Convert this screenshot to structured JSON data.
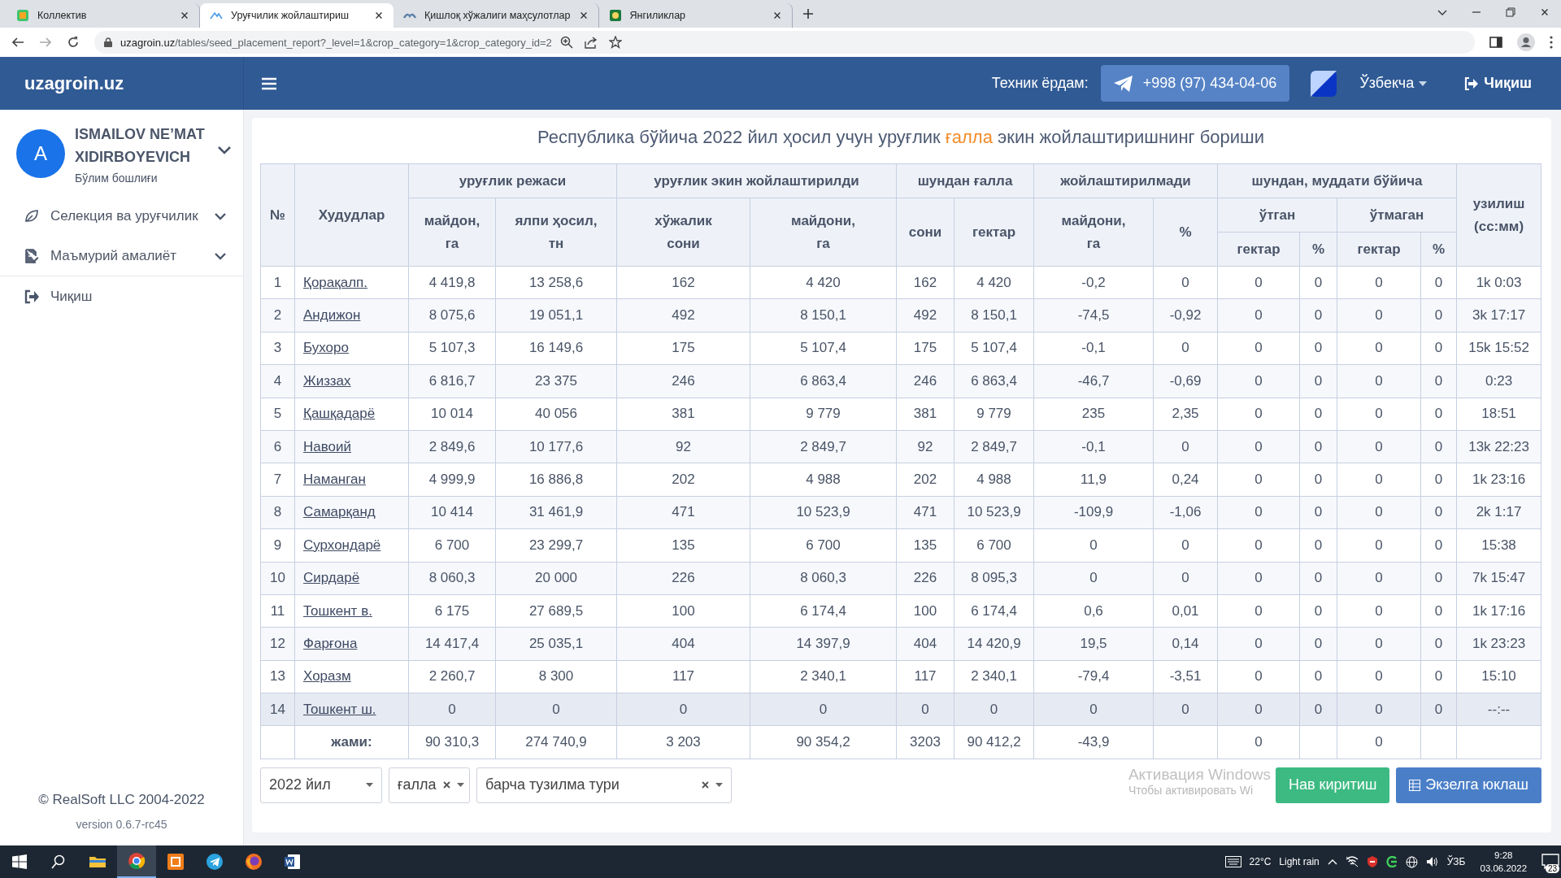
{
  "browser": {
    "tabs": [
      {
        "title": "Коллектив",
        "selected": false
      },
      {
        "title": "Уруғчилик жойлаштириш",
        "selected": true
      },
      {
        "title": "Қишлоқ хўжалиги маҳсулотлар",
        "selected": false
      },
      {
        "title": "Янгиликлар",
        "selected": false
      }
    ],
    "url_host": "uzagroin.uz",
    "url_path": "/tables/seed_placement_report?_level=1&crop_category=1&crop_category_id=2"
  },
  "header": {
    "brand": "uzagroin.uz",
    "support_label": "Техник ёрдам:",
    "phone": "+998 (97) 434-04-06",
    "language": "Ўзбекча",
    "logout": "Чиқиш"
  },
  "sidebar": {
    "user": {
      "initial": "A",
      "name": "ISMAILOV NE’MAT XIDIRBOYEVICH",
      "role": "Бўлим бошлиғи"
    },
    "menu": [
      {
        "kind": "leaf",
        "label": "Селекция ва уруғчилик",
        "expandable": true
      },
      {
        "kind": "document",
        "label": "Маъмурий амалиёт",
        "expandable": true
      },
      {
        "kind": "exit",
        "label": "Чиқиш",
        "expandable": false
      }
    ],
    "copyright": "© RealSoft LLC 2004-2022",
    "version": "version 0.6.7-rc45"
  },
  "report": {
    "title_before": "Республика бўйича 2022 йил ҳосил учун уруғлик ",
    "title_highlight": "ғалла",
    "title_after": " экин жойлаштиришнинг бориши",
    "header_rows": [
      [
        {
          "text": "№",
          "rowspan": 3
        },
        {
          "text": "Худудлар",
          "rowspan": 3
        },
        {
          "text": "уруғлик режаси",
          "colspan": 2
        },
        {
          "text": "уруғлик экин жойлаштирилди",
          "colspan": 2
        },
        {
          "text": "шундан ғалла",
          "colspan": 2
        },
        {
          "text": "жойлаштирилмади",
          "colspan": 2
        },
        {
          "text": "шундан, муддати бўйича",
          "colspan": 4
        },
        {
          "text": "узилиш\n(сс:мм)",
          "rowspan": 3
        }
      ],
      [
        {
          "text": "майдон,\nга",
          "rowspan": 2
        },
        {
          "text": "ялпи ҳосил,\nтн",
          "rowspan": 2
        },
        {
          "text": "хўжалик\nсони",
          "rowspan": 2
        },
        {
          "text": "майдони,\nга",
          "rowspan": 2
        },
        {
          "text": "сони",
          "rowspan": 2
        },
        {
          "text": "гектар",
          "rowspan": 2
        },
        {
          "text": "майдони,\nга",
          "rowspan": 2
        },
        {
          "text": "%",
          "rowspan": 2
        },
        {
          "text": "ўтган",
          "colspan": 2
        },
        {
          "text": "ўтмаган",
          "colspan": 2
        }
      ],
      [
        {
          "text": "гектар"
        },
        {
          "text": "%"
        },
        {
          "text": "гектар"
        },
        {
          "text": "%"
        }
      ]
    ],
    "rows": [
      {
        "no": "1",
        "region": "Қорақалп.",
        "highlighted": false,
        "values": [
          "4 419,8",
          "13 258,6",
          "162",
          "4 420",
          "162",
          "4 420",
          "-0,2",
          "0",
          "0",
          "0",
          "0",
          "0",
          "1k 0:03"
        ]
      },
      {
        "no": "2",
        "region": "Андижон",
        "highlighted": false,
        "values": [
          "8 075,6",
          "19 051,1",
          "492",
          "8 150,1",
          "492",
          "8 150,1",
          "-74,5",
          "-0,92",
          "0",
          "0",
          "0",
          "0",
          "3k 17:17"
        ]
      },
      {
        "no": "3",
        "region": "Бухоро",
        "highlighted": false,
        "values": [
          "5 107,3",
          "16 149,6",
          "175",
          "5 107,4",
          "175",
          "5 107,4",
          "-0,1",
          "0",
          "0",
          "0",
          "0",
          "0",
          "15k 15:52"
        ]
      },
      {
        "no": "4",
        "region": "Жиззах",
        "highlighted": false,
        "values": [
          "6 816,7",
          "23 375",
          "246",
          "6 863,4",
          "246",
          "6 863,4",
          "-46,7",
          "-0,69",
          "0",
          "0",
          "0",
          "0",
          "0:23"
        ]
      },
      {
        "no": "5",
        "region": "Қашқадарё",
        "highlighted": false,
        "values": [
          "10 014",
          "40 056",
          "381",
          "9 779",
          "381",
          "9 779",
          "235",
          "2,35",
          "0",
          "0",
          "0",
          "0",
          "18:51"
        ]
      },
      {
        "no": "6",
        "region": "Навоий",
        "highlighted": false,
        "values": [
          "2 849,6",
          "10 177,6",
          "92",
          "2 849,7",
          "92",
          "2 849,7",
          "-0,1",
          "0",
          "0",
          "0",
          "0",
          "0",
          "13k 22:23"
        ]
      },
      {
        "no": "7",
        "region": "Наманган",
        "highlighted": false,
        "values": [
          "4 999,9",
          "16 886,8",
          "202",
          "4 988",
          "202",
          "4 988",
          "11,9",
          "0,24",
          "0",
          "0",
          "0",
          "0",
          "1k 23:16"
        ]
      },
      {
        "no": "8",
        "region": "Самарқанд",
        "highlighted": false,
        "values": [
          "10 414",
          "31 461,9",
          "471",
          "10 523,9",
          "471",
          "10 523,9",
          "-109,9",
          "-1,06",
          "0",
          "0",
          "0",
          "0",
          "2k 1:17"
        ]
      },
      {
        "no": "9",
        "region": "Сурхондарё",
        "highlighted": false,
        "values": [
          "6 700",
          "23 299,7",
          "135",
          "6 700",
          "135",
          "6 700",
          "0",
          "0",
          "0",
          "0",
          "0",
          "0",
          "15:38"
        ]
      },
      {
        "no": "10",
        "region": "Сирдарё",
        "highlighted": false,
        "values": [
          "8 060,3",
          "20 000",
          "226",
          "8 060,3",
          "226",
          "8 095,3",
          "0",
          "0",
          "0",
          "0",
          "0",
          "0",
          "7k 15:47"
        ]
      },
      {
        "no": "11",
        "region": "Тошкент в.",
        "highlighted": false,
        "values": [
          "6 175",
          "27 689,5",
          "100",
          "6 174,4",
          "100",
          "6 174,4",
          "0,6",
          "0,01",
          "0",
          "0",
          "0",
          "0",
          "1k 17:16"
        ]
      },
      {
        "no": "12",
        "region": "Фарғона",
        "highlighted": false,
        "values": [
          "14 417,4",
          "25 035,1",
          "404",
          "14 397,9",
          "404",
          "14 420,9",
          "19,5",
          "0,14",
          "0",
          "0",
          "0",
          "0",
          "1k 23:23"
        ]
      },
      {
        "no": "13",
        "region": "Хоразм",
        "highlighted": false,
        "values": [
          "2 260,7",
          "8 300",
          "117",
          "2 340,1",
          "117",
          "2 340,1",
          "-79,4",
          "-3,51",
          "0",
          "0",
          "0",
          "0",
          "15:10"
        ]
      },
      {
        "no": "14",
        "region": "Тошкент ш.",
        "highlighted": true,
        "values": [
          "0",
          "0",
          "0",
          "0",
          "0",
          "0",
          "0",
          "0",
          "0",
          "0",
          "0",
          "0",
          "--:--"
        ]
      }
    ],
    "total": {
      "label": "жами:",
      "cells": [
        {
          "kind": "value",
          "value": "90 310,3"
        },
        {
          "kind": "value",
          "value": "274 740,9"
        },
        {
          "kind": "value",
          "value": "3 203"
        },
        {
          "kind": "value",
          "value": "90 354,2"
        },
        {
          "kind": "value",
          "value": "3203"
        },
        {
          "kind": "value",
          "value": "90 412,2"
        },
        {
          "kind": "value",
          "value": "-43,9"
        },
        {
          "kind": "empty"
        },
        {
          "kind": "value",
          "value": "0"
        },
        {
          "kind": "empty"
        },
        {
          "kind": "value",
          "value": "0"
        },
        {
          "kind": "empty"
        },
        {
          "kind": "empty"
        }
      ]
    },
    "filters": [
      {
        "value": "2022 йил",
        "clearable": false
      },
      {
        "value": "ғалла",
        "clearable": true
      },
      {
        "value": "барча тузилма тури",
        "clearable": true
      }
    ],
    "buttons": [
      {
        "kind": "add",
        "label": "Нав киритиш"
      },
      {
        "kind": "export",
        "label": "Экзелга юклаш"
      }
    ]
  },
  "os_notice": {
    "title": "Активация Windows",
    "text": "Чтобы активировать Wi"
  },
  "taskbar": {
    "apps": [
      {
        "kind": "explorer",
        "selected": false
      },
      {
        "kind": "chrome",
        "selected": true
      },
      {
        "kind": "orange",
        "selected": false
      },
      {
        "kind": "telegram",
        "selected": false
      },
      {
        "kind": "firefox",
        "selected": false
      },
      {
        "kind": "word",
        "selected": false
      }
    ],
    "temperature": "22°C",
    "weather": "Light rain",
    "language": "ЎЗБ",
    "time": "9:28",
    "date": "03.06.2022",
    "notifications": "23"
  }
}
